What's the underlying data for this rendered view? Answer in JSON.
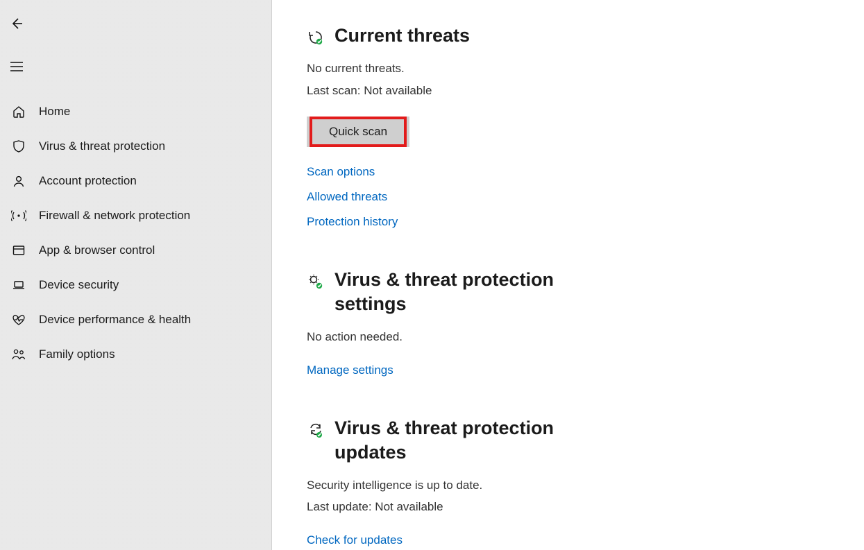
{
  "sidebar": {
    "items": [
      {
        "label": "Home"
      },
      {
        "label": "Virus & threat protection"
      },
      {
        "label": "Account protection"
      },
      {
        "label": "Firewall & network protection"
      },
      {
        "label": "App & browser control"
      },
      {
        "label": "Device security"
      },
      {
        "label": "Device performance & health"
      },
      {
        "label": "Family options"
      }
    ]
  },
  "main": {
    "threats": {
      "title": "Current threats",
      "line1": "No current threats.",
      "line2": "Last scan: Not available",
      "quick_scan": "Quick scan",
      "scan_options": "Scan options",
      "allowed_threats": "Allowed threats",
      "protection_history": "Protection history"
    },
    "settings": {
      "title": "Virus & threat protection settings",
      "line1": "No action needed.",
      "manage": "Manage settings"
    },
    "updates": {
      "title": "Virus & threat protection updates",
      "line1": "Security intelligence is up to date.",
      "line2": "Last update: Not available",
      "check": "Check for updates"
    }
  }
}
